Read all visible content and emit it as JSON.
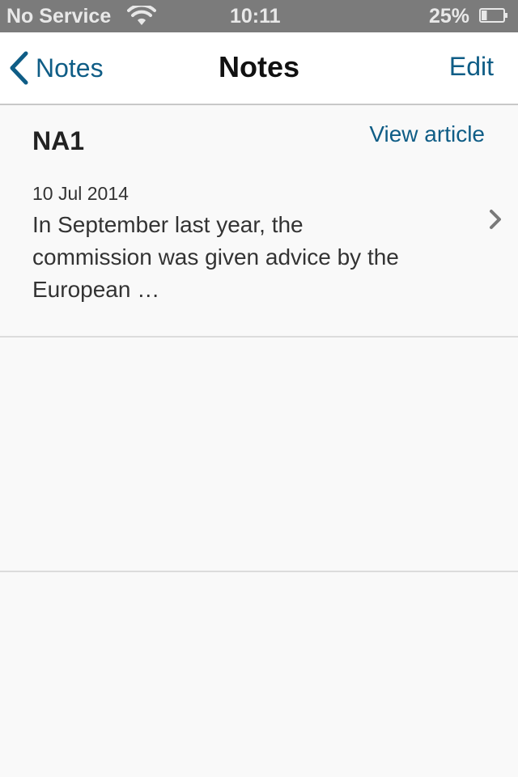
{
  "status_bar": {
    "carrier": "No Service",
    "time": "10:11",
    "battery_percent": "25%",
    "battery_level": 0.25,
    "wifi_icon": "wifi-icon",
    "battery_icon": "battery-icon"
  },
  "nav": {
    "back_label": "Notes",
    "title": "Notes",
    "edit_label": "Edit",
    "back_icon": "chevron-left-icon"
  },
  "notes": [
    {
      "title": "NA1",
      "view_article_label": "View article",
      "date": "10 Jul 2014",
      "excerpt": "In September last year, the commission was given advice by the European …",
      "disclosure_icon": "chevron-right-icon"
    }
  ],
  "colors": {
    "accent": "#0f5d86",
    "status_bar_bg": "#7b7b7b",
    "background": "#f9f9f9"
  }
}
